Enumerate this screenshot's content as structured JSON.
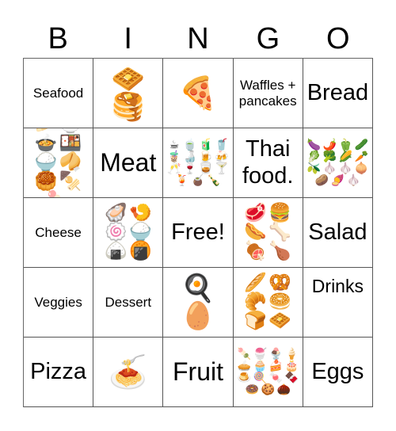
{
  "header": {
    "letters": [
      "B",
      "I",
      "N",
      "G",
      "O"
    ]
  },
  "board": {
    "rows": [
      [
        {
          "type": "text",
          "text": "Seafood"
        },
        {
          "type": "emoji",
          "emojis": [
            "🧇",
            "🥞"
          ]
        },
        {
          "type": "emoji",
          "emojis": [
            "🍕"
          ]
        },
        {
          "type": "text",
          "text": "Waffles + pancakes"
        },
        {
          "type": "text",
          "text": "Bread"
        }
      ],
      [
        {
          "type": "emoji",
          "emojis": [
            "🥟",
            "🍜",
            "🍲",
            "🍱",
            "🍚",
            "🥠",
            "🥮",
            "🍢",
            "🍡"
          ]
        },
        {
          "type": "text",
          "text": "Meat"
        },
        {
          "type": "emoji",
          "emojis": [
            "☕",
            "🍵",
            "🧃",
            "🥤",
            "🧋",
            "🍶",
            "🍺",
            "🍻",
            "🥂",
            "🍷",
            "🥃",
            "🍸",
            "🍹",
            "🧉",
            "🍾"
          ]
        },
        {
          "type": "text",
          "text": "Thai food."
        },
        {
          "type": "emoji",
          "emojis": [
            "🍆",
            "🌶️",
            "🫑",
            "🥒",
            "🥬",
            "🥦",
            "🌽",
            "🥕",
            "🫒",
            "🧄",
            "🧄",
            "🧅",
            "🥔",
            "🍠",
            "🧄"
          ]
        }
      ],
      [
        {
          "type": "text",
          "text": "Cheese"
        },
        {
          "type": "emoji",
          "emojis": [
            "🦪",
            "🍤",
            "🍥",
            "🍚",
            "🍙",
            "🍘"
          ]
        },
        {
          "type": "text",
          "text": "Free!"
        },
        {
          "type": "emoji",
          "emojis": [
            "🥩",
            "🍔",
            "🌭",
            "🦴",
            "🍖",
            "🍗"
          ]
        },
        {
          "type": "text",
          "text": "Salad"
        }
      ],
      [
        {
          "type": "text",
          "text": "Veggies"
        },
        {
          "type": "text",
          "text": "Dessert"
        },
        {
          "type": "emoji",
          "emojis": [
            "🍳",
            "🥚"
          ]
        },
        {
          "type": "emoji",
          "emojis": [
            "🥖",
            "🥨",
            "🥐",
            "🥯",
            "🍞",
            "🧇"
          ]
        },
        {
          "type": "text",
          "text": "Drinks"
        }
      ],
      [
        {
          "type": "text",
          "text": "Pizza"
        },
        {
          "type": "emoji",
          "emojis": [
            "🍝"
          ]
        },
        {
          "type": "text",
          "text": "Fruit"
        },
        {
          "type": "emoji",
          "emojis": [
            "🍡",
            "🍧",
            "🍨",
            "🍦",
            "🥧",
            "🧁",
            "🍰",
            "🎂",
            "🍮",
            "🍭",
            "🍬",
            "🍫",
            "🍩",
            "🍪",
            "🌰"
          ]
        },
        {
          "type": "text",
          "text": "Eggs"
        }
      ]
    ]
  }
}
